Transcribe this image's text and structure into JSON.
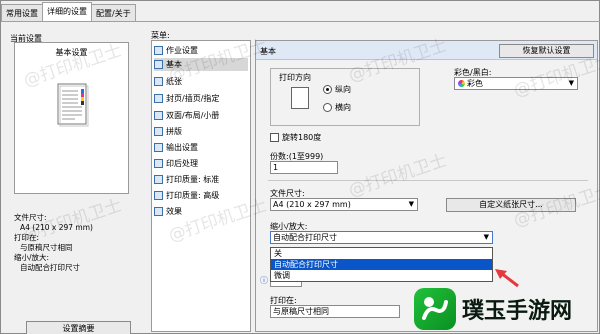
{
  "tabs": [
    "常用设置",
    "详细的设置",
    "配置/关于"
  ],
  "left": {
    "current_label": "当前设置",
    "current_title": "基本设置",
    "summary": {
      "file_size_label": "文件尺寸:",
      "file_size_value": "A4 (210 x 297 mm)",
      "print_on_label": "打印在:",
      "print_on_value": "与原稿尺寸相同",
      "zoom_label": "缩小/放大:",
      "zoom_value": "自动配合打印尺寸"
    },
    "summary_button": "设置摘要"
  },
  "menu": {
    "label": "菜单:",
    "items": [
      "作业设置",
      "基本",
      "纸张",
      "封页/插页/指定",
      "双面/布局/小册",
      "拼版",
      "输出设置",
      "印后处理",
      "打印质量: 标准",
      "打印质量: 高级",
      "效果"
    ],
    "selected_index": 1
  },
  "panel": {
    "title": "基本",
    "restore_button": "恢复默认设置",
    "orientation": {
      "label": "打印方向",
      "portrait": "纵向",
      "landscape": "横向",
      "selected": "portrait"
    },
    "color": {
      "label": "彩色/黑白:",
      "value": "彩色"
    },
    "rotate_label": "旋转180度",
    "copies": {
      "label": "份数:(1至999)",
      "value": "1"
    },
    "file_size": {
      "label": "文件尺寸:",
      "value": "A4 (210 x 297 mm)",
      "custom_button": "自定义纸张尺寸..."
    },
    "zoom": {
      "label": "缩小/放大:",
      "value": "自动配合打印尺寸",
      "options": [
        "关",
        "自动配合打印尺寸",
        "微调"
      ],
      "highlighted_index": 1
    },
    "print_on": {
      "label": "打印在:",
      "value": "与原稿尺寸相同"
    }
  },
  "watermark": "@打印机卫士",
  "logo_text": "璞玉手游网",
  "colors": {
    "highlight": "#0a55c8",
    "header": "#dfe9f6",
    "arrow": "#e5393d",
    "logo_green": "#1bb33a"
  }
}
